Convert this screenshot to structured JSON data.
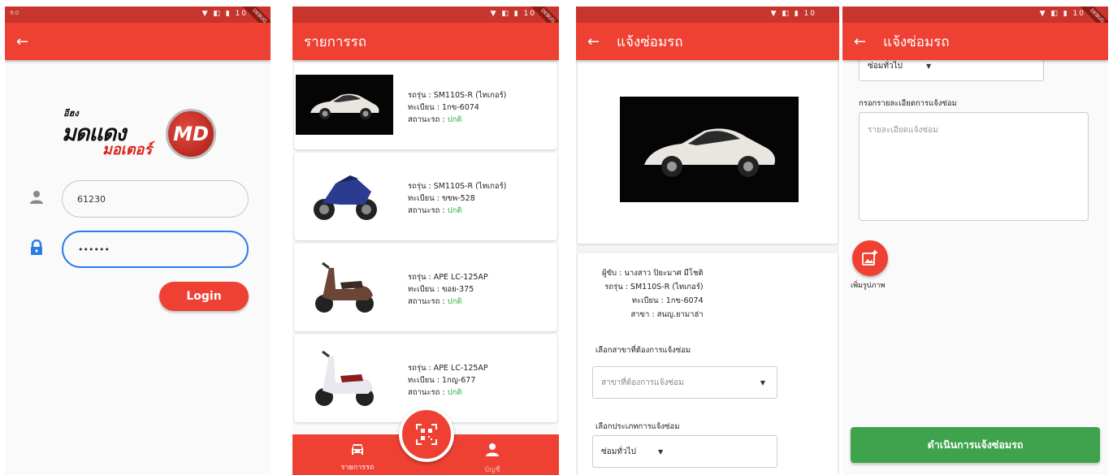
{
  "status_icons": "▼ ◧ ▮ 10",
  "status_left": "9:0",
  "debug_ribbon": "DEBUG",
  "login": {
    "logo_small": "อีฮง",
    "logo_big1": "มดแดง",
    "logo_big2": "มอเตอร์",
    "logo_badge": "MD",
    "username_value": "61230",
    "password_value": "••••••",
    "login_button": "Login"
  },
  "list": {
    "title": "รายการรถ",
    "cards": [
      {
        "model": "รถรุ่น : SM110S-R  (ไทเกอร์)",
        "plate": "ทะเบียน : 1กข-6074",
        "status_prefix": "สถานะรถ : ",
        "status": "ปกติ"
      },
      {
        "model": "รถรุ่น : SM110S-R  (ไทเกอร์)",
        "plate": "ทะเบียน : ขขพ-528",
        "status_prefix": "สถานะรถ : ",
        "status": "ปกติ"
      },
      {
        "model": "รถรุ่น : APE    LC-125AP",
        "plate": "ทะเบียน : ขอย-375",
        "status_prefix": "สถานะรถ : ",
        "status": "ปกติ"
      },
      {
        "model": "รถรุ่น : APE    LC-125AP",
        "plate": "ทะเบียน : 1กญ-677",
        "status_prefix": "สถานะรถ : ",
        "status": "ปกติ"
      }
    ],
    "nav_cars": "รายการรถ",
    "nav_profile": "บัญชี"
  },
  "repair": {
    "title": "แจ้งซ่อมรถ",
    "owner": "ผู้ขับ : นางสาว ปิยะมาศ มีโชติ",
    "model": "รถรุ่น : SM110S-R (ไทเกอร์)",
    "plate": "ทะเบียน : 1กข-6074",
    "branch": "สาขา : สนญ.ยามาฮ่า",
    "branch_label": "เลือกสาขาที่ต้องการแจ้งซ่อม",
    "branch_placeholder": "สาขาที่ต้องการแจ้งซ่อม",
    "type_label": "เลือกประเภทการแจ้งซ่อม",
    "type_value": "ซ่อมทั่วไป"
  },
  "repair2": {
    "title": "แจ้งซ่อมรถ",
    "type_value": "ซ่อมทั่วไป",
    "detail_label": "กรอกรายละเอียดการแจ้งซ่อม",
    "detail_placeholder": "รายละเอียดแจ้งซ่อม",
    "add_image": "เพิ่มรูปภาพ",
    "submit": "ดำเนินการแจ้งซ่อมรถ"
  }
}
